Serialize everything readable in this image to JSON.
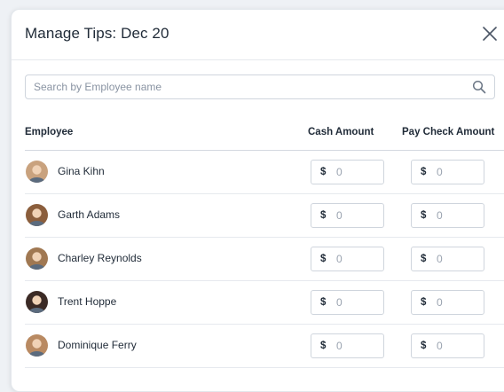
{
  "modal": {
    "title": "Manage Tips: Dec 20",
    "close_icon": "close-icon"
  },
  "search": {
    "placeholder": "Search by Employee name",
    "value": "",
    "icon": "search-icon"
  },
  "table": {
    "columns": {
      "employee": "Employee",
      "cash": "Cash Amount",
      "paycheck": "Pay Check Amount"
    },
    "currency_symbol": "$",
    "rows": [
      {
        "name": "Gina Kihn",
        "cash_placeholder": "0",
        "paycheck_placeholder": "0",
        "avatar_color": "#c9a27e"
      },
      {
        "name": "Garth Adams",
        "cash_placeholder": "0",
        "paycheck_placeholder": "0",
        "avatar_color": "#8b5e3c"
      },
      {
        "name": "Charley Reynolds",
        "cash_placeholder": "0",
        "paycheck_placeholder": "0",
        "avatar_color": "#a07852"
      },
      {
        "name": "Trent Hoppe",
        "cash_placeholder": "0",
        "paycheck_placeholder": "0",
        "avatar_color": "#3b2a25"
      },
      {
        "name": "Dominique Ferry",
        "cash_placeholder": "0",
        "paycheck_placeholder": "0",
        "avatar_color": "#b98a62"
      }
    ]
  },
  "colors": {
    "text": "#1f2a37",
    "border": "#cfd5dd",
    "divider": "#e6e9ee",
    "placeholder": "#8a94a3"
  }
}
